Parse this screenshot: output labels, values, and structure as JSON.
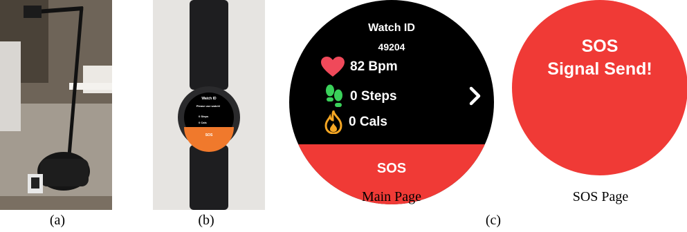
{
  "panels": {
    "a": {
      "label": "(a)"
    },
    "b": {
      "label": "(b)",
      "watch_screen": {
        "title": "Watch ID",
        "line1": "Please use watch!",
        "steps": "0 Steps",
        "cals": "0 Cals",
        "button": "SOS"
      }
    },
    "c": {
      "label": "(c)"
    }
  },
  "main_page": {
    "caption": "Main Page",
    "title": "Watch ID",
    "watch_id": "49204",
    "heart_rate": "82 Bpm",
    "steps": "0 Steps",
    "calories": "0 Cals",
    "sos_button": "SOS",
    "colors": {
      "background": "#000000",
      "sos": "#f03a36",
      "heart": "#f0495a",
      "steps": "#3ad15a",
      "flame": "#f5a623"
    }
  },
  "sos_page": {
    "caption": "SOS Page",
    "title": "SOS",
    "message": "Signal Send!"
  }
}
